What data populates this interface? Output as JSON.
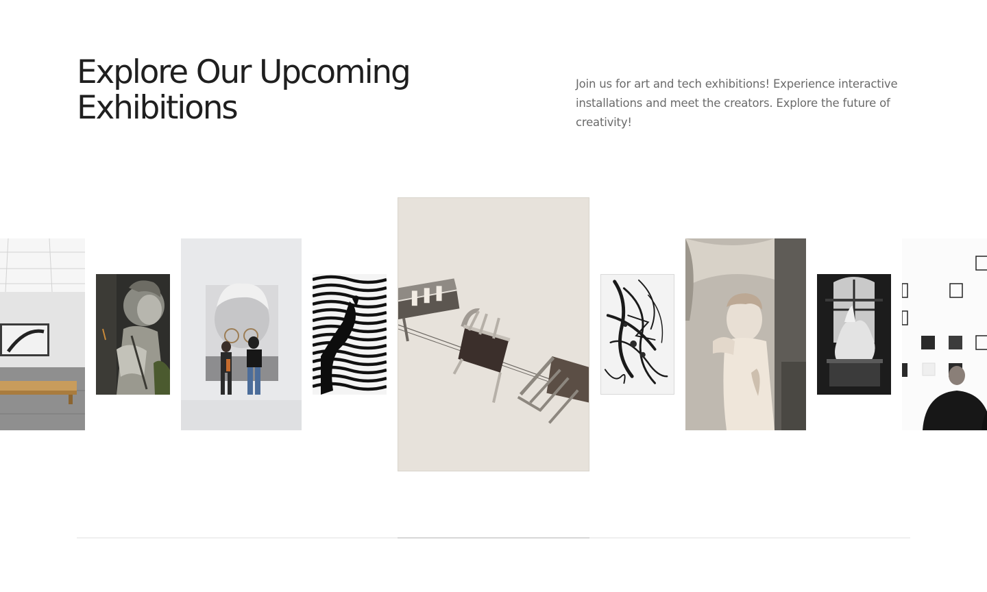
{
  "header": {
    "title_line1": "Explore Our Upcoming",
    "title_line2": "Exhibitions",
    "description": "Join us for art and tech exhibitions! Experience interactive installations and meet the creators. Explore the future of creativity!"
  },
  "carousel": {
    "card_count": 9,
    "active_index": 5,
    "cards": [
      {
        "subject": "gallery-room-bench-photo"
      },
      {
        "subject": "stone-statue-photo"
      },
      {
        "subject": "visitors-viewing-portrait-photo"
      },
      {
        "subject": "wavy-stripes-figure-art"
      },
      {
        "subject": "floating-chairs-photo"
      },
      {
        "subject": "ink-brush-strokes-art"
      },
      {
        "subject": "david-statue-photo"
      },
      {
        "subject": "sculpture-by-window-photo"
      },
      {
        "subject": "visitors-frames-wall-photo"
      }
    ],
    "progress": {
      "start_fraction": 0.385,
      "end_fraction": 0.615
    }
  },
  "colors": {
    "heading": "#1f1f1f",
    "body_text": "#6a6a6a",
    "progress_track": "#efefef",
    "progress_fill": "#d7d7d7"
  }
}
